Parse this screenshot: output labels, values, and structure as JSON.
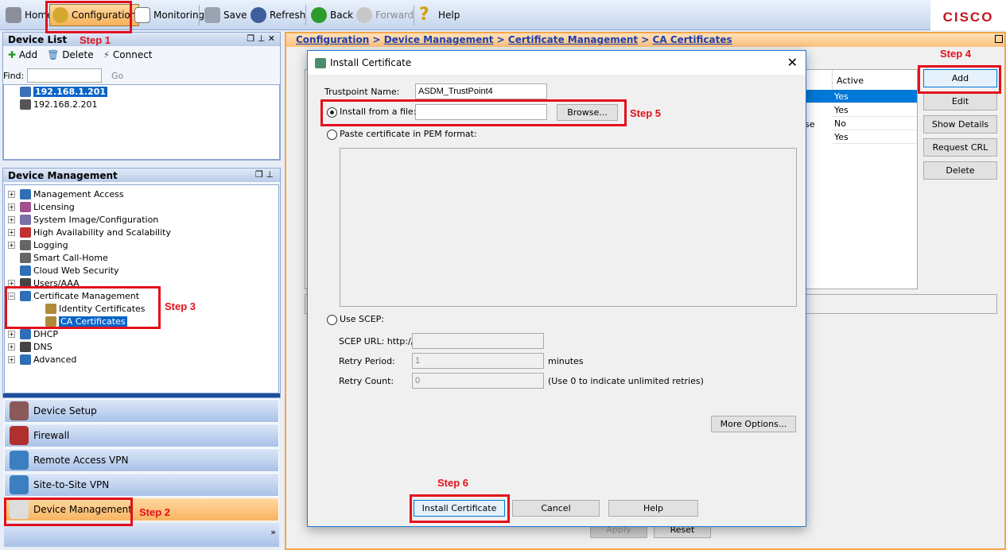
{
  "toolbar": {
    "home": "Home",
    "configuration": "Configuration",
    "monitoring": "Monitoring",
    "save": "Save",
    "refresh": "Refresh",
    "back": "Back",
    "forward": "Forward",
    "help": "Help",
    "brand": "CISCO"
  },
  "device_list": {
    "title": "Device List",
    "add": "Add",
    "delete": "Delete",
    "connect": "Connect",
    "find_label": "Find:",
    "find_value": "",
    "go": "Go",
    "devices": [
      "192.168.1.201",
      "192.168.2.201"
    ]
  },
  "device_management": {
    "title": "Device Management",
    "items": [
      "Management Access",
      "Licensing",
      "System Image/Configuration",
      "High Availability and Scalability",
      "Logging",
      "Smart Call-Home",
      "Cloud Web Security",
      "Users/AAA",
      "Certificate Management",
      "Identity Certificates",
      "CA Certificates",
      "DHCP",
      "DNS",
      "Advanced"
    ]
  },
  "nav": {
    "items": [
      "Device Setup",
      "Firewall",
      "Remote Access VPN",
      "Site-to-Site VPN",
      "Device Management"
    ],
    "active": "Device Management",
    "more": "»"
  },
  "breadcrumb": [
    "Configuration",
    "Device Management",
    "Certificate Management",
    "CA Certificates"
  ],
  "table": {
    "active_header": "Active",
    "partial_cell": "se",
    "rows": [
      "Yes",
      "Yes",
      "No",
      "Yes"
    ]
  },
  "side_buttons": [
    "Add",
    "Edit",
    "Show Details",
    "Request CRL",
    "Delete"
  ],
  "footer_buttons": {
    "apply": "Apply",
    "reset": "Reset"
  },
  "dialog": {
    "title": "Install Certificate",
    "trustpoint_label": "Trustpoint Name:",
    "trustpoint_value": "ASDM_TrustPoint4",
    "install_file_label": "Install from a file:",
    "install_file_value": "",
    "browse": "Browse...",
    "paste_label": "Paste certificate in PEM format:",
    "paste_value": "",
    "scep_label": "Use SCEP:",
    "scep_url_label": "SCEP URL: http://",
    "scep_url_value": "",
    "retry_period_label": "Retry Period:",
    "retry_period_value": "1",
    "retry_period_unit": "minutes",
    "retry_count_label": "Retry Count:",
    "retry_count_value": "0",
    "retry_count_hint": "(Use 0 to indicate unlimited retries)",
    "more_options": "More Options...",
    "install": "Install Certificate",
    "cancel": "Cancel",
    "help": "Help",
    "selected_option": "Install from a file"
  },
  "annotations": [
    "Step 1",
    "Step 2",
    "Step 3",
    "Step 4",
    "Step 5",
    "Step 6"
  ],
  "colors": {
    "accent_orange": "#f7b25a",
    "selection_blue": "#0078d7",
    "annotation_red": "#e3101c"
  }
}
